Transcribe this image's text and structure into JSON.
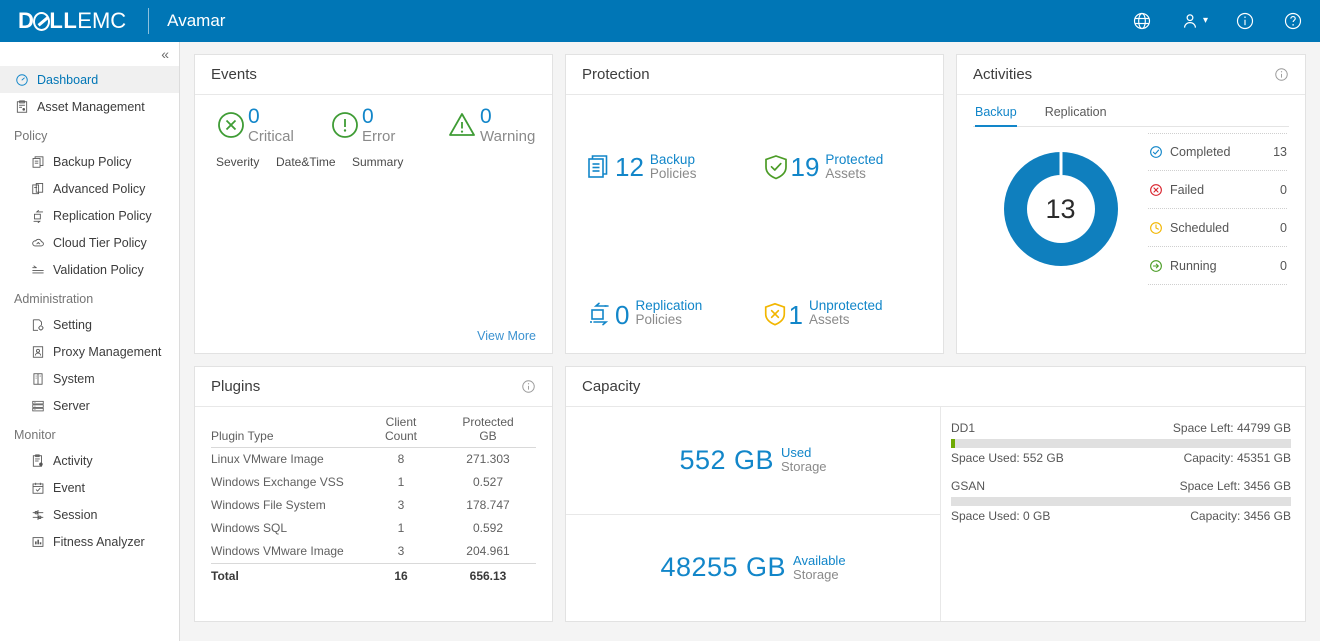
{
  "header": {
    "brand_dell": "D LL",
    "brand_emc": "EMC",
    "app_title": "Avamar",
    "icons": [
      "globe-icon",
      "user-icon",
      "info-icon",
      "help-icon"
    ]
  },
  "sidebar": {
    "collapse_label": "«",
    "items": [
      {
        "label": "Dashboard",
        "icon": "dashboard-icon",
        "type": "item",
        "active": true
      },
      {
        "label": "Asset Management",
        "icon": "asset-management-icon",
        "type": "item",
        "active": false
      },
      {
        "label": "Policy",
        "icon": "",
        "type": "group",
        "active": false
      },
      {
        "label": "Backup Policy",
        "icon": "backup-policy-icon",
        "type": "sub",
        "active": false
      },
      {
        "label": "Advanced Policy",
        "icon": "advanced-policy-icon",
        "type": "sub",
        "active": false
      },
      {
        "label": "Replication Policy",
        "icon": "replication-policy-icon",
        "type": "sub",
        "active": false
      },
      {
        "label": "Cloud Tier Policy",
        "icon": "cloud-tier-policy-icon",
        "type": "sub",
        "active": false
      },
      {
        "label": "Validation Policy",
        "icon": "validation-policy-icon",
        "type": "sub",
        "active": false
      },
      {
        "label": "Administration",
        "icon": "",
        "type": "group",
        "active": false
      },
      {
        "label": "Setting",
        "icon": "setting-icon",
        "type": "sub",
        "active": false
      },
      {
        "label": "Proxy Management",
        "icon": "proxy-management-icon",
        "type": "sub",
        "active": false
      },
      {
        "label": "System",
        "icon": "system-icon",
        "type": "sub",
        "active": false
      },
      {
        "label": "Server",
        "icon": "server-icon",
        "type": "sub",
        "active": false
      },
      {
        "label": "Monitor",
        "icon": "",
        "type": "group",
        "active": false
      },
      {
        "label": "Activity",
        "icon": "activity-icon",
        "type": "sub",
        "active": false
      },
      {
        "label": "Event",
        "icon": "event-icon",
        "type": "sub",
        "active": false
      },
      {
        "label": "Session",
        "icon": "session-icon",
        "type": "sub",
        "active": false
      },
      {
        "label": "Fitness Analyzer",
        "icon": "fitness-analyzer-icon",
        "type": "sub",
        "active": false
      }
    ]
  },
  "events": {
    "title": "Events",
    "severities": [
      {
        "count": "0",
        "label": "Critical",
        "icon": "critical-circle-x-icon"
      },
      {
        "count": "0",
        "label": "Error",
        "icon": "error-circle-exclaim-icon"
      },
      {
        "count": "0",
        "label": "Warning",
        "icon": "warning-triangle-icon"
      }
    ],
    "columns": [
      "Severity",
      "Date&Time",
      "Summary"
    ],
    "view_more": "View More"
  },
  "protection": {
    "title": "Protection",
    "items": [
      {
        "count": "12",
        "line1": "Backup",
        "line2": "Policies",
        "icon": "backup-policies-icon"
      },
      {
        "count": "19",
        "line1": "Protected",
        "line2": "Assets",
        "icon": "protected-assets-shield-icon"
      },
      {
        "count": "0",
        "line1": "Replication",
        "line2": "Policies",
        "icon": "replication-policies-icon"
      },
      {
        "count": "1",
        "line1": "Unprotected",
        "line2": "Assets",
        "icon": "unprotected-assets-shield-icon"
      }
    ]
  },
  "activities": {
    "title": "Activities",
    "tabs": [
      {
        "label": "Backup",
        "active": true
      },
      {
        "label": "Replication",
        "active": false
      }
    ],
    "donut_total": "13",
    "stats": [
      {
        "label": "Completed",
        "value": "13",
        "icon": "completed-check-icon",
        "color": "#1286c9"
      },
      {
        "label": "Failed",
        "value": "0",
        "icon": "failed-x-icon",
        "color": "#d9232d"
      },
      {
        "label": "Scheduled",
        "value": "0",
        "icon": "scheduled-clock-icon",
        "color": "#f2b600"
      },
      {
        "label": "Running",
        "value": "0",
        "icon": "running-arrow-icon",
        "color": "#4b9c26"
      }
    ]
  },
  "plugins": {
    "title": "Plugins",
    "columns": [
      "Plugin Type",
      "Client\nCount",
      "Protected\nGB"
    ],
    "col_plugin_type": "Plugin Type",
    "col_client_count_l1": "Client",
    "col_client_count_l2": "Count",
    "col_protected_l1": "Protected",
    "col_protected_l2": "GB",
    "rows": [
      {
        "type": "Linux VMware Image",
        "count": "8",
        "gb": "271.303"
      },
      {
        "type": "Windows Exchange VSS",
        "count": "1",
        "gb": "0.527"
      },
      {
        "type": "Windows File System",
        "count": "3",
        "gb": "178.747"
      },
      {
        "type": "Windows SQL",
        "count": "1",
        "gb": "0.592"
      },
      {
        "type": "Windows VMware Image",
        "count": "3",
        "gb": "204.961"
      }
    ],
    "total": {
      "type": "Total",
      "count": "16",
      "gb": "656.13"
    }
  },
  "capacity": {
    "title": "Capacity",
    "used": {
      "value": "552 GB",
      "line1": "Used",
      "line2": "Storage"
    },
    "available": {
      "value": "48255 GB",
      "line1": "Available",
      "line2": "Storage"
    },
    "stores": [
      {
        "name": "DD1",
        "space_left": "Space Left: 44799 GB",
        "space_used": "Space Used: 552 GB",
        "capacity": "Capacity: 45351 GB",
        "fill_percent": 1.2
      },
      {
        "name": "GSAN",
        "space_left": "Space Left: 3456 GB",
        "space_used": "Space Used: 0 GB",
        "capacity": "Capacity: 3456 GB",
        "fill_percent": 0
      }
    ]
  },
  "colors": {
    "brand_blue": "#0076b6",
    "accent_blue": "#1286c9",
    "green": "#4b9c26",
    "bar_green": "#6faa04",
    "amber": "#f2b600",
    "red": "#d9232d"
  }
}
